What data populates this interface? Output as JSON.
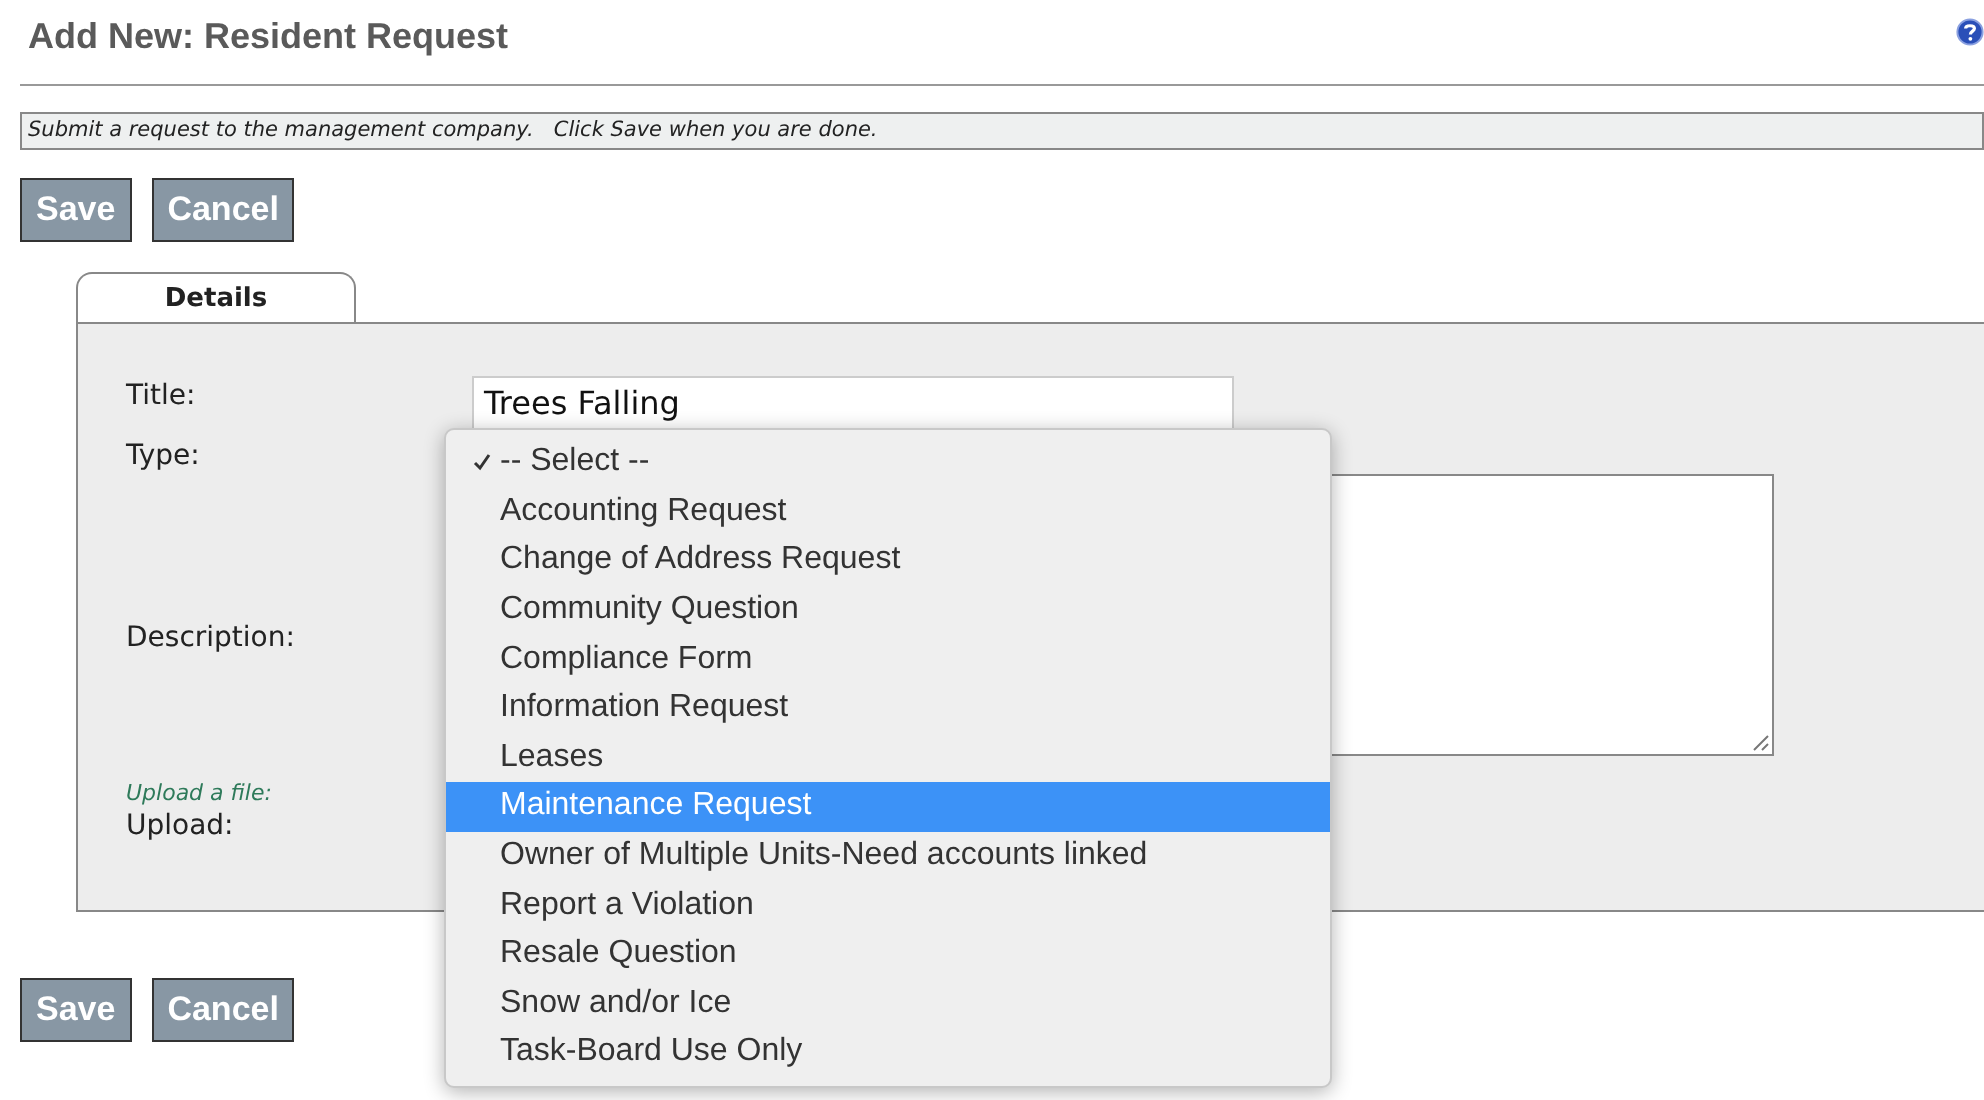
{
  "page": {
    "title": "Add New: Resident Request",
    "instructions": "Submit a request to the management company.   Click Save when you are done."
  },
  "top_buttons": [
    "Save",
    "Cancel"
  ],
  "tabs": [
    {
      "label": "Details",
      "selected": true
    }
  ],
  "form": {
    "title_label": "Title:",
    "title_value": "Trees Falling",
    "type_label": "Type:",
    "description_label": "Description:",
    "upload_hint": "Upload a file:",
    "upload_label": "Upload:"
  },
  "type_menu": [
    {
      "label": "-- Select --",
      "checked": true,
      "highlighted": false
    },
    {
      "label": "Accounting Request",
      "checked": false,
      "highlighted": false
    },
    {
      "label": "Change of Address Request",
      "checked": false,
      "highlighted": false
    },
    {
      "label": "Community Question",
      "checked": false,
      "highlighted": false
    },
    {
      "label": "Compliance Form",
      "checked": false,
      "highlighted": false
    },
    {
      "label": "Information Request",
      "checked": false,
      "highlighted": false
    },
    {
      "label": "Leases",
      "checked": false,
      "highlighted": false
    },
    {
      "label": "Maintenance Request",
      "checked": false,
      "highlighted": true
    },
    {
      "label": "Owner of Multiple Units-Need accounts linked",
      "checked": false,
      "highlighted": false
    },
    {
      "label": "Report a Violation",
      "checked": false,
      "highlighted": false
    },
    {
      "label": "Resale Question",
      "checked": false,
      "highlighted": false
    },
    {
      "label": "Snow and/or Ice",
      "checked": false,
      "highlighted": false
    },
    {
      "label": "Task-Board Use Only",
      "checked": false,
      "highlighted": false
    }
  ],
  "bottom_buttons": [
    "Save",
    "Cancel"
  ]
}
